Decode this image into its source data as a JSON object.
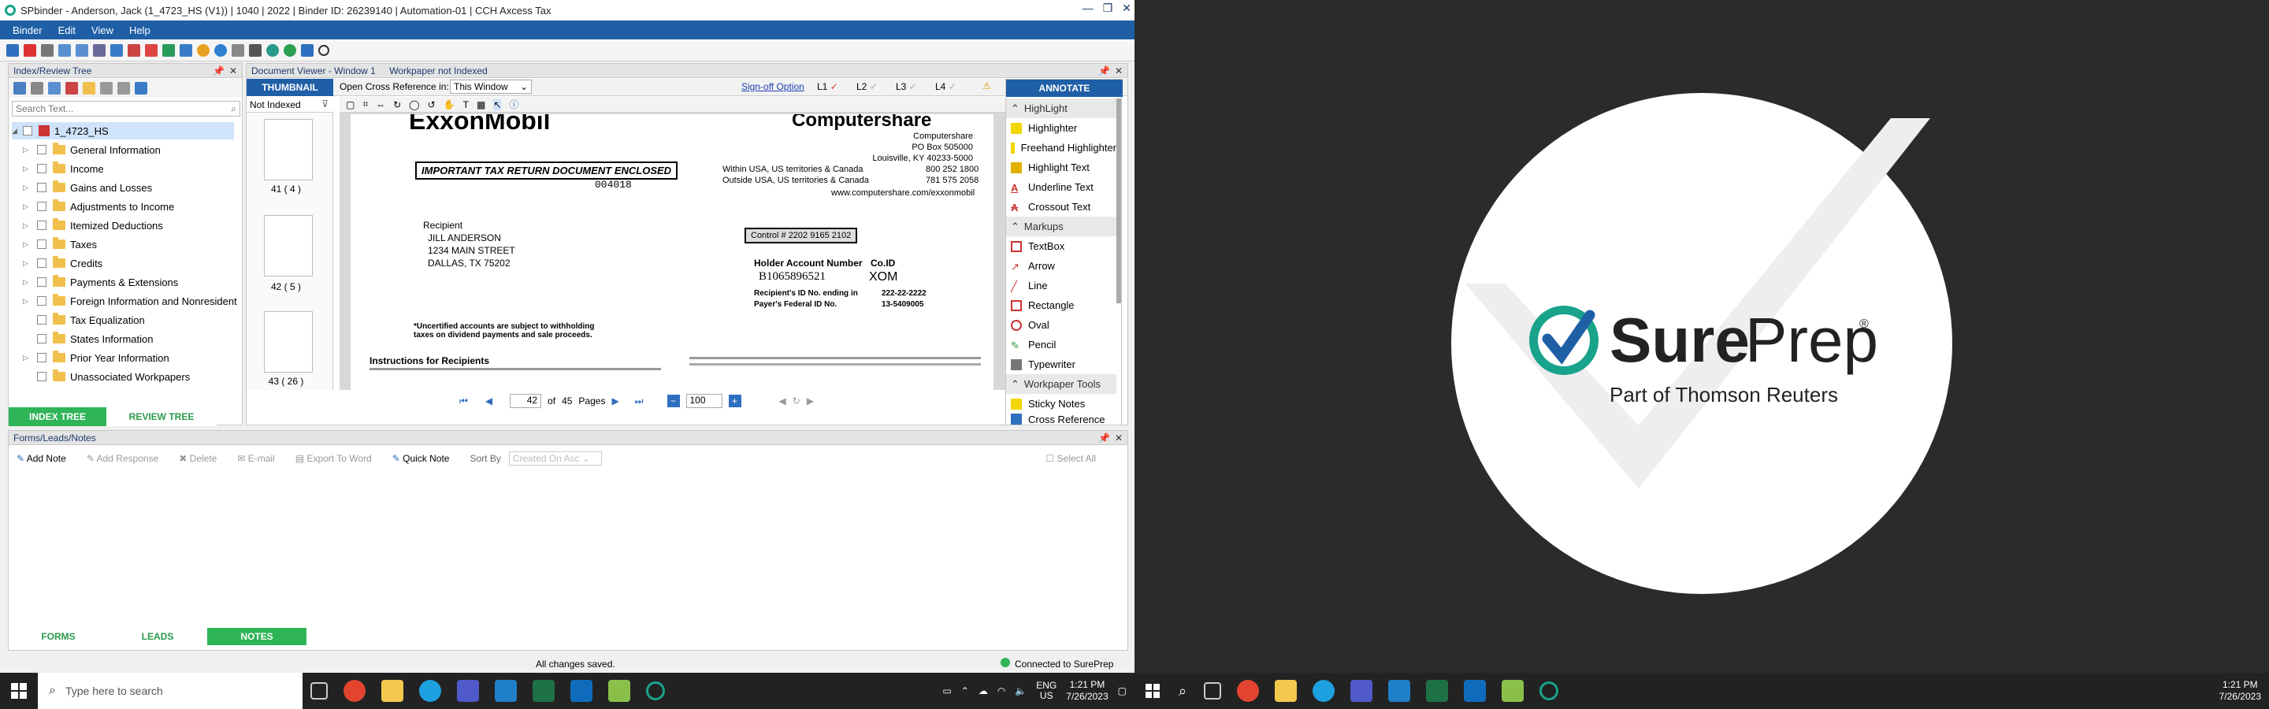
{
  "window": {
    "title": "SPbinder - Anderson, Jack (1_4723_HS (V1)) | 1040 | 2022 | Binder ID: 26239140 | Automation-01 | CCH Axcess Tax"
  },
  "menu": [
    "Binder",
    "Edit",
    "View",
    "Help"
  ],
  "index_panel": {
    "title": "Index/Review Tree",
    "search_placeholder": "Search Text...",
    "root": "1_4723_HS",
    "items": [
      "General Information",
      "Income",
      "Gains and Losses",
      "Adjustments to Income",
      "Itemized Deductions",
      "Taxes",
      "Credits",
      "Payments & Extensions",
      "Foreign Information and Nonresident",
      "Tax Equalization",
      "States Information",
      "Prior Year Information",
      "Unassociated Workpapers"
    ],
    "tabs": [
      "INDEX TREE",
      "REVIEW TREE"
    ]
  },
  "doc_viewer": {
    "title": "Document Viewer - Window 1",
    "status": "Workpaper not Indexed",
    "thumbnail_label": "THUMBNAIL",
    "cross_ref_label": "Open Cross Reference in:",
    "cross_ref_value": "This Window",
    "signoff": "Sign-off Option",
    "levels": [
      "L1",
      "L2",
      "L3",
      "L4"
    ],
    "not_indexed": "Not Indexed",
    "thumbs": [
      "41 ( 4 )",
      "42 ( 5 )",
      "43 ( 26 )"
    ],
    "page_current": "42",
    "page_of": "of",
    "page_total": "45",
    "pages_word": "Pages",
    "zoom": "100"
  },
  "document": {
    "exxon": "ExxonMobil",
    "important": "IMPORTANT TAX RETURN DOCUMENT ENCLOSED",
    "doc_code": "004018",
    "computershare": "Computershare",
    "cs_addr": [
      "Computershare",
      "PO Box 505000",
      "Louisville, KY 40233-5000"
    ],
    "cs_phone1_label": "Within USA, US territories & Canada",
    "cs_phone1": "800 252 1800",
    "cs_phone2_label": "Outside USA, US territories & Canada",
    "cs_phone2": "781 575 2058",
    "cs_web": "www.computershare.com/exxonmobil",
    "control": "Control # 2202 9165 2102",
    "recipient_label": "Recipient",
    "recipient": [
      "JILL ANDERSON",
      "1234 MAIN STREET",
      "DALLAS, TX 75202"
    ],
    "holder_label": "Holder Account Number",
    "holder_value": "B1065896521",
    "coid_label": "Co.ID",
    "coid_value": "XOM",
    "recip_id_label": "Recipient's ID No. ending in",
    "recip_id_value": "222-22-2222",
    "payer_label": "Payer's Federal ID No.",
    "payer_value": "13-5409005",
    "note": "*Uncertified accounts are subject to withholding taxes on dividend payments and sale proceeds.",
    "instructions": "Instructions for Recipients"
  },
  "annotate": {
    "title": "ANNOTATE",
    "sections": {
      "highlight": "HighLight",
      "markups": "Markups",
      "tools": "Workpaper Tools"
    },
    "highlight_items": [
      "Highlighter",
      "Freehand Highlighter",
      "Highlight Text",
      "Underline Text",
      "Crossout Text"
    ],
    "markup_items": [
      "TextBox",
      "Arrow",
      "Line",
      "Rectangle",
      "Oval",
      "Pencil",
      "Typewriter"
    ],
    "tool_items": [
      "Sticky Notes",
      "Cross Reference"
    ]
  },
  "notes_panel": {
    "title": "Forms/Leads/Notes",
    "buttons": [
      "Add Note",
      "Add Response",
      "Delete",
      "E-mail",
      "Export To Word",
      "Quick Note"
    ],
    "sort_by": "Sort By",
    "sort_value": "Created On Asc",
    "select_all": "Select All",
    "tabs": [
      "FORMS",
      "LEADS",
      "NOTES"
    ]
  },
  "status": {
    "saved": "All changes saved.",
    "connected": "Connected to SurePrep"
  },
  "taskbar": {
    "search_placeholder": "Type here to search",
    "lang1": "ENG",
    "lang2": "US",
    "time": "1:21 PM",
    "date": "7/26/2023"
  },
  "splash": {
    "brand_a": "Sure",
    "brand_b": "Prep",
    "reg": "®",
    "tagline": "Part of Thomson Reuters"
  },
  "colors": {
    "accent": "#1f5fa6",
    "green": "#2fb457",
    "sureprep_teal": "#19a38b"
  }
}
